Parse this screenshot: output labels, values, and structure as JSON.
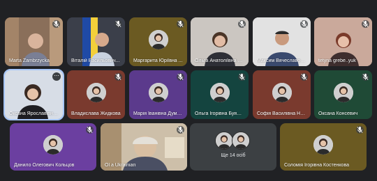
{
  "row1": [
    {
      "name": "Marta Zambrzycka"
    },
    {
      "name": "Віталій Васильович..."
    },
    {
      "name": "Маргарита Юріївна ..."
    },
    {
      "name": "Ольга Анатоліївна Де..."
    },
    {
      "name": "Максим Вячеславови..."
    },
    {
      "name": "tetyna grebe..yuk"
    }
  ],
  "row2": [
    {
      "name": "Оксана Ярославівна ..."
    },
    {
      "name": "Владислава Жидкова"
    },
    {
      "name": "Марія Іванівна Думан..."
    },
    {
      "name": "Ольга Ігорівна Буяльс..."
    },
    {
      "name": "Софія Василівна Неч..."
    },
    {
      "name": "Оксана Консевич"
    }
  ],
  "row3": [
    {
      "name": "Данило Олегович Кольцов"
    },
    {
      "name": "Ol a Ukrainian"
    },
    {
      "more_label": "Ще 14 осіб"
    },
    {
      "name": "Соломія Ігорівна Костенкова"
    }
  ],
  "more_button_label": "⋯",
  "colors": {
    "background": "#202124",
    "tile_purple": "#6b3fa0",
    "tile_brown": "#7a3a2e",
    "tile_olive": "#6b5a22",
    "tile_teal": "#14443f",
    "tile_green": "#1f4a36",
    "tile_gray": "#3c4043",
    "speaking_outline": "#a8c7fa"
  },
  "icons": {
    "mic_muted": "mic-muted-icon",
    "more_options": "more-options-icon"
  }
}
